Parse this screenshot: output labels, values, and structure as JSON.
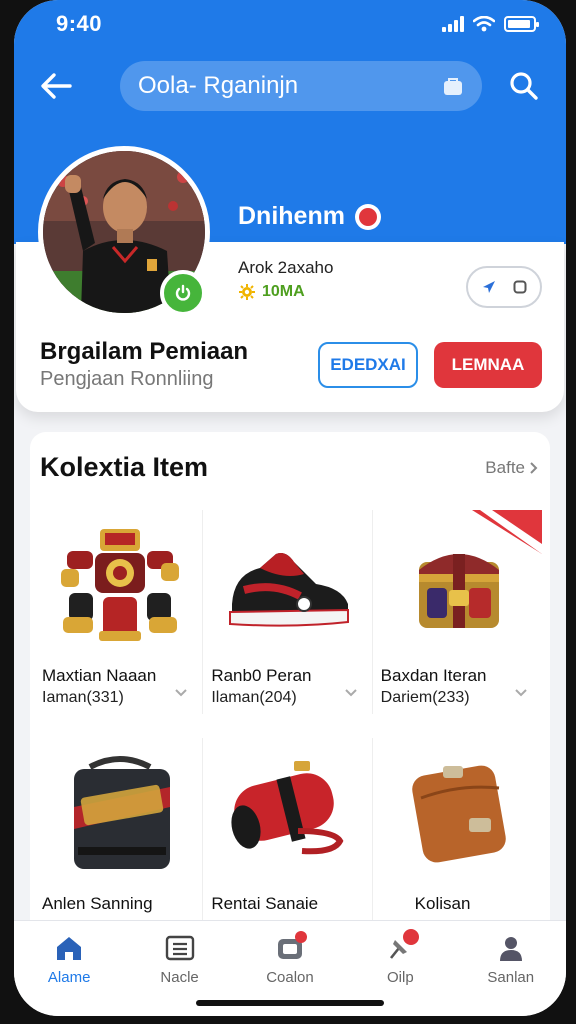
{
  "status": {
    "time": "9:40"
  },
  "search": {
    "text": "Oola- Rganinjn"
  },
  "profile": {
    "name": "Dnihenm",
    "handle": "Arok 2axaho",
    "level": "10MA",
    "section_title": "Brgailam Pemiaan",
    "section_subtitle": "Pengjaan Ronnliing",
    "btn_outline": "EDEDXAI",
    "btn_primary": "LEMNAA"
  },
  "collection": {
    "title": "Kolextia Item",
    "see_all": "Bafte",
    "items": [
      {
        "name": "Maxtian Naaan",
        "meta": "Iaman(331)",
        "icon": "trophy-robot"
      },
      {
        "name": "Ranb0 Peran",
        "meta": "Ilaman(204)",
        "icon": "sneaker"
      },
      {
        "name": "Baxdan Iteran",
        "meta": "Dariem(233)",
        "icon": "treasure-chest"
      },
      {
        "name": "Anlen Sanning",
        "meta": "",
        "icon": "sports-bag"
      },
      {
        "name": "Rentai Sanaie",
        "meta": "",
        "icon": "duffel-bag"
      },
      {
        "name": "Kolisan",
        "meta": "",
        "icon": "leather-pouch"
      }
    ]
  },
  "tabs": [
    {
      "label": "Alame",
      "icon": "home-icon",
      "active": true
    },
    {
      "label": "Nacle",
      "icon": "list-icon",
      "active": false
    },
    {
      "label": "Coalon",
      "icon": "gift-icon",
      "active": false
    },
    {
      "label": "Oilp",
      "icon": "pin-icon",
      "active": false
    },
    {
      "label": "Sanlan",
      "icon": "person-icon",
      "active": false
    }
  ],
  "colors": {
    "primary": "#1f7ae8",
    "accent_red": "#e0363c",
    "online_green": "#46b53b"
  }
}
